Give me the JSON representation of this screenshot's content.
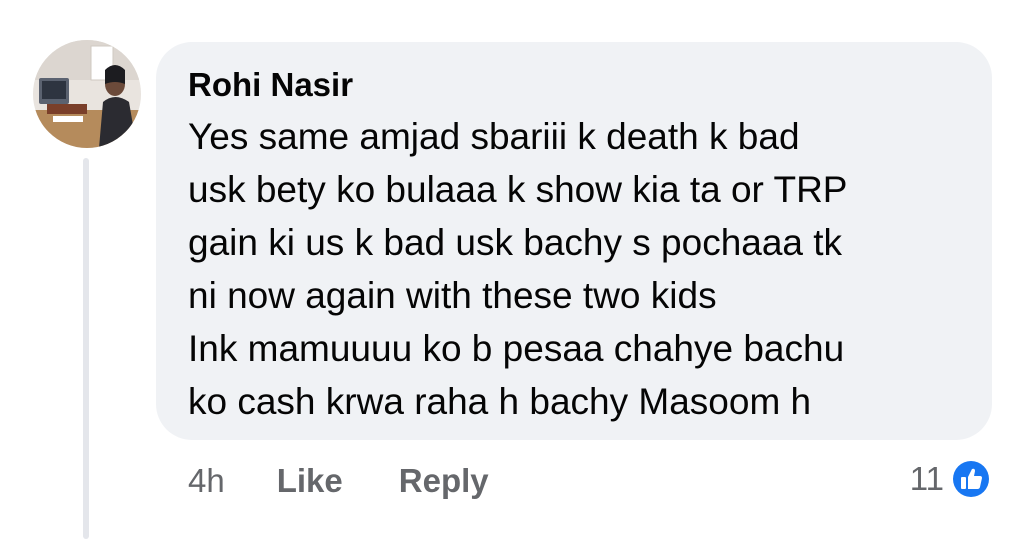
{
  "comment": {
    "author": "Rohi Nasir",
    "text": "Yes same amjad sbariii k death k bad\nusk bety ko bulaaa k show kia ta or TRP\ngain ki us k bad usk bachy s pochaaa tk\nni now again with these two kids\nInk mamuuuu ko b pesaa chahye bachu\nko cash krwa raha h bachy Masoom h"
  },
  "actions": {
    "time": "4h",
    "like_label": "Like",
    "reply_label": "Reply"
  },
  "reactions": {
    "count": "11",
    "icon": "like-reaction-icon",
    "color": "#1877f2"
  },
  "colors": {
    "bubble": "#f0f2f5",
    "secondary_text": "#65676b",
    "primary_text": "#050505"
  }
}
